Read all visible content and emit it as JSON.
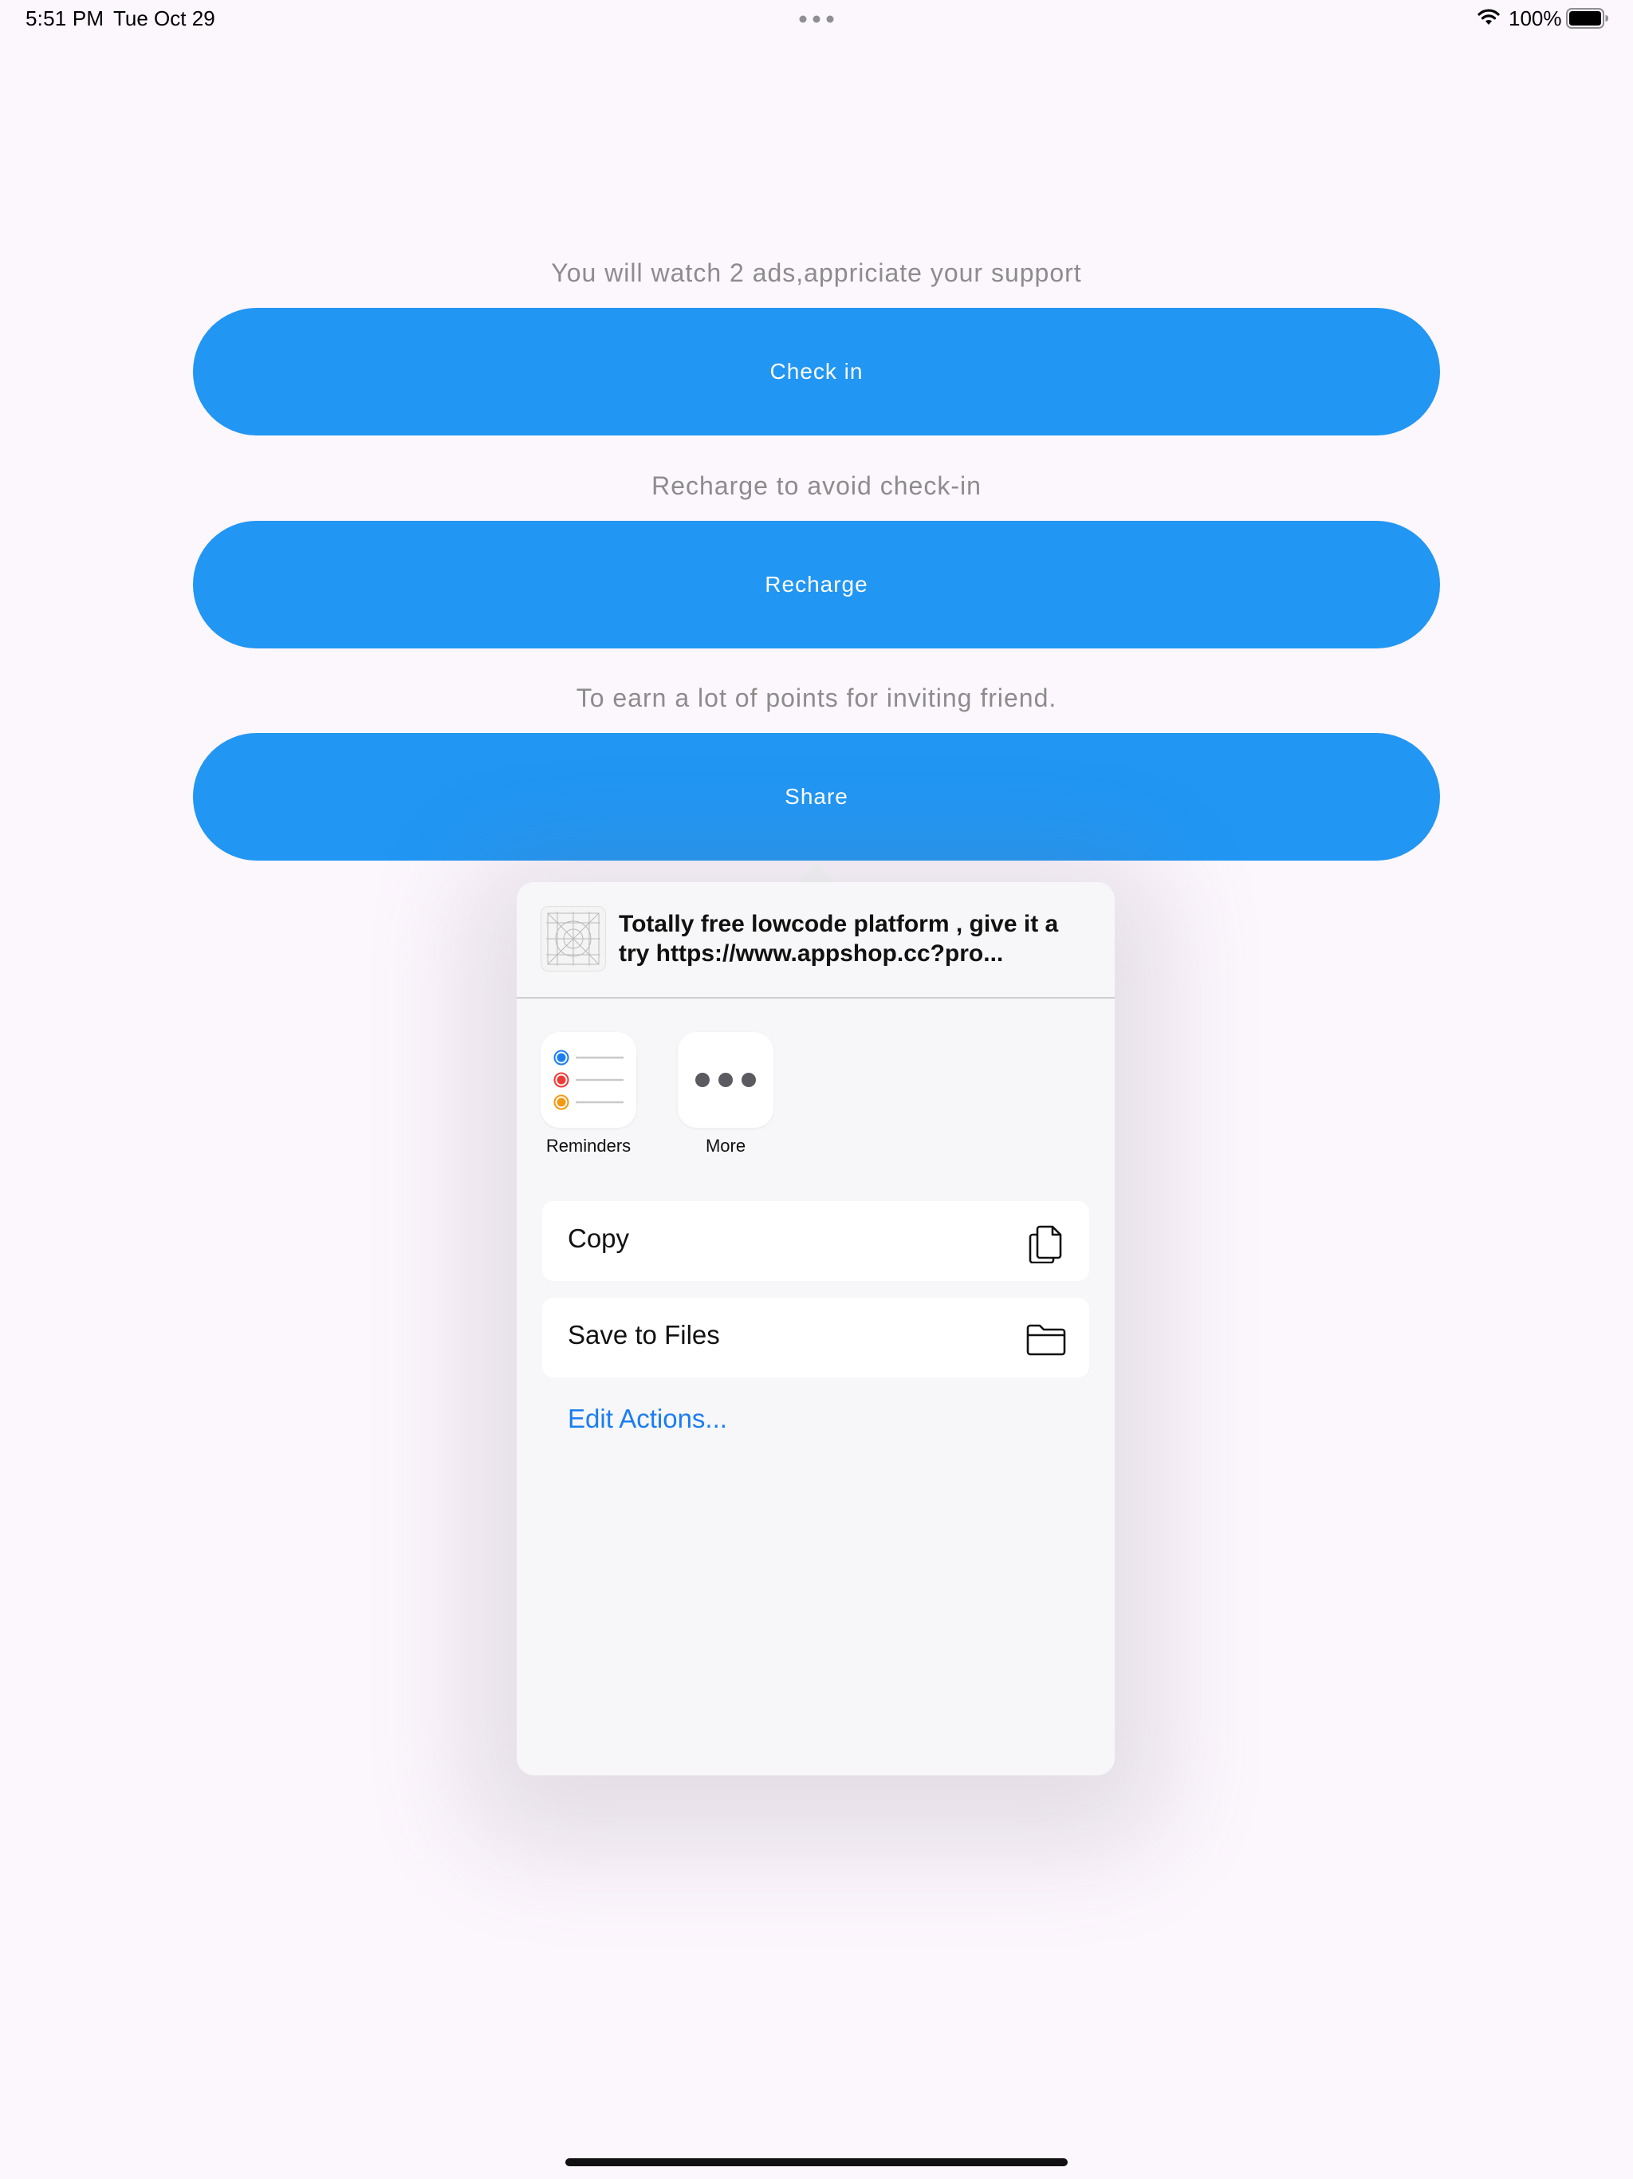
{
  "status_bar": {
    "time": "5:51 PM",
    "date": "Tue Oct 29",
    "battery_percent": "100%",
    "battery_level": 1.0
  },
  "main": {
    "checkin_caption": "You will watch 2 ads,appriciate your support",
    "checkin_button": "Check in",
    "recharge_caption": "Recharge to avoid check-in",
    "recharge_button": "Recharge",
    "share_caption": "To earn a lot of points for inviting friend.",
    "share_button": "Share"
  },
  "share_sheet": {
    "title": "Totally free lowcode platform , give it a try https://www.appshop.cc?pro...",
    "apps": [
      {
        "label": "Reminders",
        "icon": "reminders-icon"
      },
      {
        "label": "More",
        "icon": "more-icon"
      }
    ],
    "actions": [
      {
        "label": "Copy",
        "icon": "copy-icon"
      },
      {
        "label": "Save to Files",
        "icon": "folder-icon"
      }
    ],
    "edit_actions": "Edit Actions..."
  },
  "colors": {
    "background": "#fcf6fd",
    "button": "#2196f3",
    "caption": "#8c8c8c",
    "link": "#1a7ef2",
    "sheet": "#f7f6f8"
  }
}
